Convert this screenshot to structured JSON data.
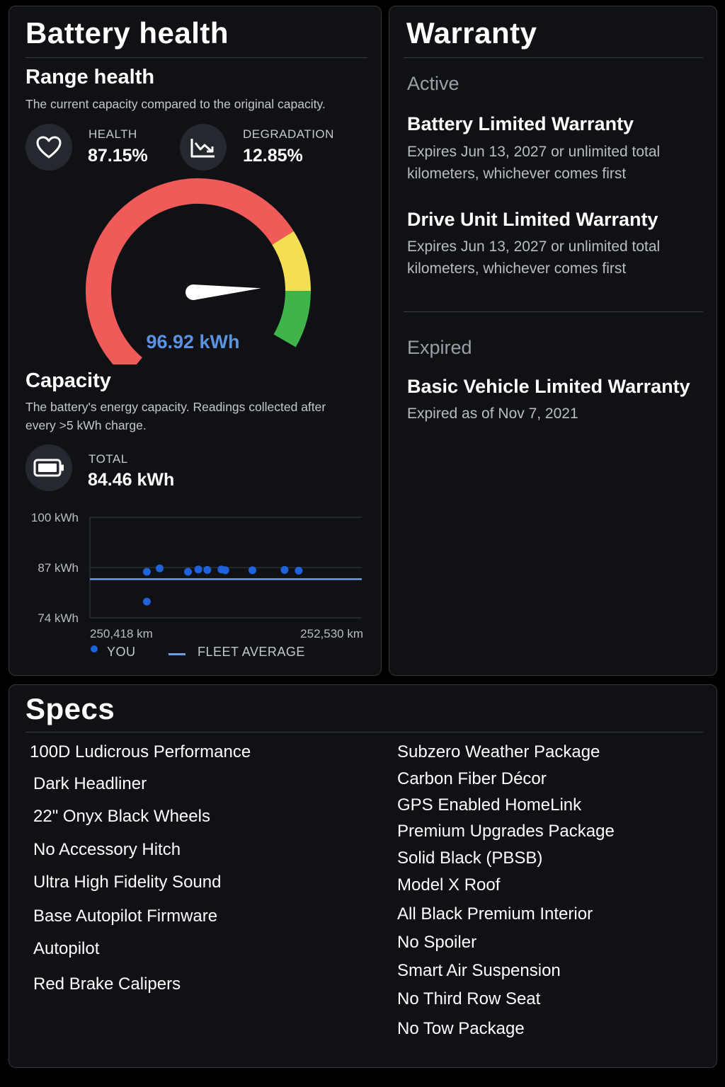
{
  "battery": {
    "title": "Battery health",
    "range": {
      "title": "Range health",
      "description": "The current capacity compared to the original capacity.",
      "health_label": "HEALTH",
      "health_value": "87.15%",
      "degradation_label": "DEGRADATION",
      "degradation_value": "12.85%",
      "gauge_value": "96.92 kWh",
      "gauge_level": 0.8715,
      "icons": {
        "health": "heart-icon",
        "degradation": "trend-down-icon"
      }
    },
    "capacity": {
      "title": "Capacity",
      "description": "The battery's energy capacity. Readings collected after every >5 kWh charge.",
      "total_label": "TOTAL",
      "total_value": "84.46 kWh",
      "icon": "battery-icon"
    }
  },
  "chart_data": {
    "type": "scatter",
    "y_tick_labels": [
      "100 kWh",
      "87 kWh",
      "74 kWh"
    ],
    "ylim": [
      74,
      100
    ],
    "x_tick_labels": [
      "250,418 km",
      "252,530 km"
    ],
    "xlim": [
      250418,
      252530
    ],
    "grid": true,
    "legend": {
      "position": "bottom",
      "you_label": "YOU",
      "fleet_label": "FLEET AVERAGE"
    },
    "fleet_average": 84.0,
    "series": [
      {
        "name": "YOU",
        "x": [
          250860,
          250960,
          251180,
          251260,
          251330,
          251440,
          251470,
          251680,
          251930,
          252040,
          250860
        ],
        "y": [
          85.9,
          86.8,
          85.9,
          86.5,
          86.4,
          86.5,
          86.3,
          86.3,
          86.4,
          86.2,
          78.2
        ]
      }
    ],
    "colors": {
      "you": "#1f62d9",
      "fleet": "#6e9ee8"
    }
  },
  "warranty": {
    "title": "Warranty",
    "active_label": "Active",
    "active": [
      {
        "title": "Battery Limited Warranty",
        "desc": "Expires Jun 13, 2027 or unlimited total kilometers, whichever comes first"
      },
      {
        "title": "Drive Unit Limited Warranty",
        "desc": "Expires Jun 13, 2027 or unlimited total kilometers, whichever comes first"
      }
    ],
    "expired_label": "Expired",
    "expired": [
      {
        "title": "Basic Vehicle Limited Warranty",
        "desc": "Expired as of Nov 7, 2021"
      }
    ]
  },
  "specs": {
    "title": "Specs",
    "left": [
      "100D Ludicrous Performance",
      "Dark Headliner",
      "22\" Onyx Black Wheels",
      "No Accessory Hitch",
      "Ultra High Fidelity Sound",
      "Base Autopilot Firmware",
      "Autopilot",
      "Red Brake Calipers"
    ],
    "right": [
      "Subzero Weather Package",
      "Carbon Fiber Décor",
      "GPS Enabled HomeLink",
      "Premium Upgrades Package",
      "Solid Black (PBSB)",
      "Model X Roof",
      "All Black Premium Interior",
      "No Spoiler",
      "Smart Air Suspension",
      "No Third Row Seat",
      "No Tow Package"
    ]
  },
  "colors": {
    "gauge_red": "#f05a58",
    "gauge_yellow": "#f4df54",
    "gauge_green": "#3fb44a",
    "accent_blue": "#5b93e0"
  }
}
